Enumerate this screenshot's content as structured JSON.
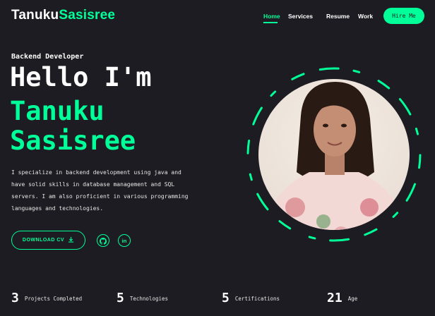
{
  "header": {
    "logo_first": "Tanuku",
    "logo_second": "Sasisree",
    "nav": [
      "Home",
      "Services",
      "Resume",
      "Work"
    ],
    "hire_label": "Hire Me"
  },
  "hero": {
    "role": "Backend Developer",
    "greeting": "Hello I'm",
    "name_line1": "Tanuku",
    "name_line2": "Sasisree",
    "bio": "I specialize in backend development using java and have solid skills in database management and SQL servers. I am also proficient in various programming languages and technologies.",
    "download_label": "DOWNLOAD CV",
    "social_linkedin": "in"
  },
  "stats": [
    {
      "number": "3",
      "label": "Projects Completed"
    },
    {
      "number": "5",
      "label": "Technologies"
    },
    {
      "number": "5",
      "label": "Certifications"
    },
    {
      "number": "21",
      "label": "Age"
    }
  ],
  "colors": {
    "background": "#1c1c22",
    "accent": "#00ff99",
    "text": "#ffffff"
  },
  "icons": [
    "download-icon",
    "github-icon",
    "linkedin-icon"
  ]
}
